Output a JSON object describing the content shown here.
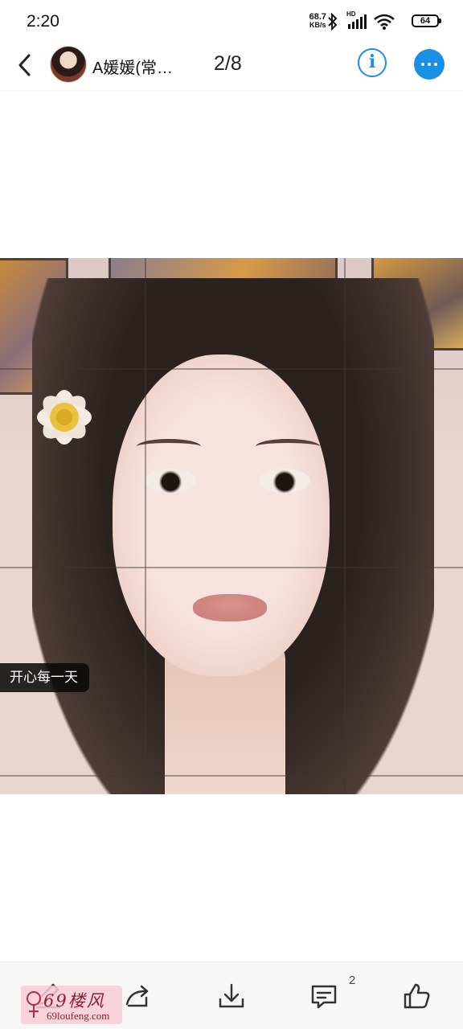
{
  "status_bar": {
    "time": "2:20",
    "net_speed_value": "68.7",
    "net_speed_unit": "KB/s",
    "hd_label": "HD",
    "battery_level": "64",
    "icons": [
      "bluetooth-icon",
      "signal-icon",
      "wifi-icon",
      "battery-icon"
    ]
  },
  "header": {
    "username": "A媛媛(常…",
    "page_counter": "2/8",
    "info_label": "i",
    "icons": [
      "back-arrow-icon",
      "info-icon",
      "more-icon"
    ],
    "accent_color": "#1a8fe6"
  },
  "photo": {
    "caption_tag": "开心每一天"
  },
  "toolbar": {
    "comment_count": "2",
    "icons": [
      "edit-icon",
      "share-icon",
      "download-icon",
      "comment-icon",
      "like-icon"
    ]
  },
  "watermark": {
    "logo_text": "69楼风",
    "url_text": "69loufeng.com"
  }
}
